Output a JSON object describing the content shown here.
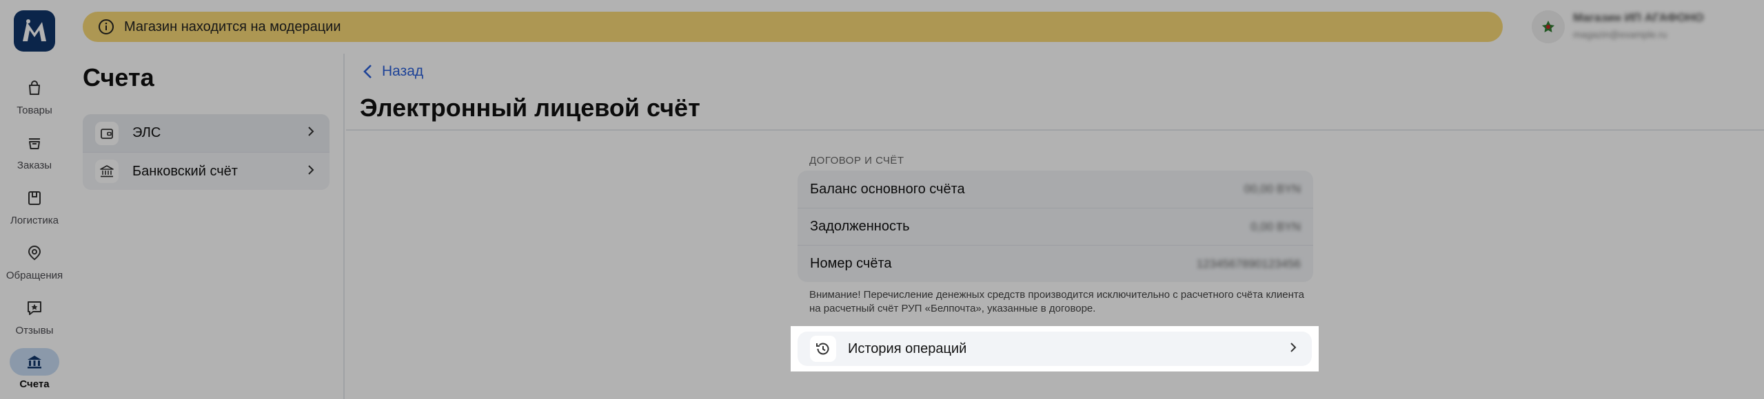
{
  "nav": {
    "items": [
      {
        "label": "Товары",
        "icon": "bag-icon"
      },
      {
        "label": "Заказы",
        "icon": "basket-icon"
      },
      {
        "label": "Логистика",
        "icon": "box-icon"
      },
      {
        "label": "Обращения",
        "icon": "support-icon"
      },
      {
        "label": "Отзывы",
        "icon": "review-star-icon"
      },
      {
        "label": "Счета",
        "icon": "bank-icon",
        "active": true
      }
    ]
  },
  "banner": {
    "text": "Магазин находится на модерации",
    "color": "#f8d978"
  },
  "user": {
    "name": "Магазин ИП АГАФОНОВ",
    "email": "magazin@example.ru"
  },
  "accounts": {
    "title": "Счета",
    "items": [
      {
        "label": "ЭЛС",
        "icon": "wallet-icon"
      },
      {
        "label": "Банковский счёт",
        "icon": "bank-icon"
      }
    ]
  },
  "detail": {
    "back_label": "Назад",
    "title": "Электронный лицевой счёт",
    "section_caption": "ДОГОВОР И СЧЁТ",
    "rows": [
      {
        "label": "Баланс основного счёта",
        "value": "00,00 BYN"
      },
      {
        "label": "Задолженность",
        "value": "0,00 BYN"
      },
      {
        "label": "Номер счёта",
        "value": "1234567890123456"
      }
    ],
    "note": "Внимание! Перечисление денежных средств производится исключительно с расчетного счёта клиента на расчетный счёт РУП «Белпочта», указанные в договоре.",
    "history_label": "История операций"
  },
  "colors": {
    "accent": "#2a5fd8",
    "logo": "#11356b",
    "active_nav": "#c7dcf4"
  }
}
